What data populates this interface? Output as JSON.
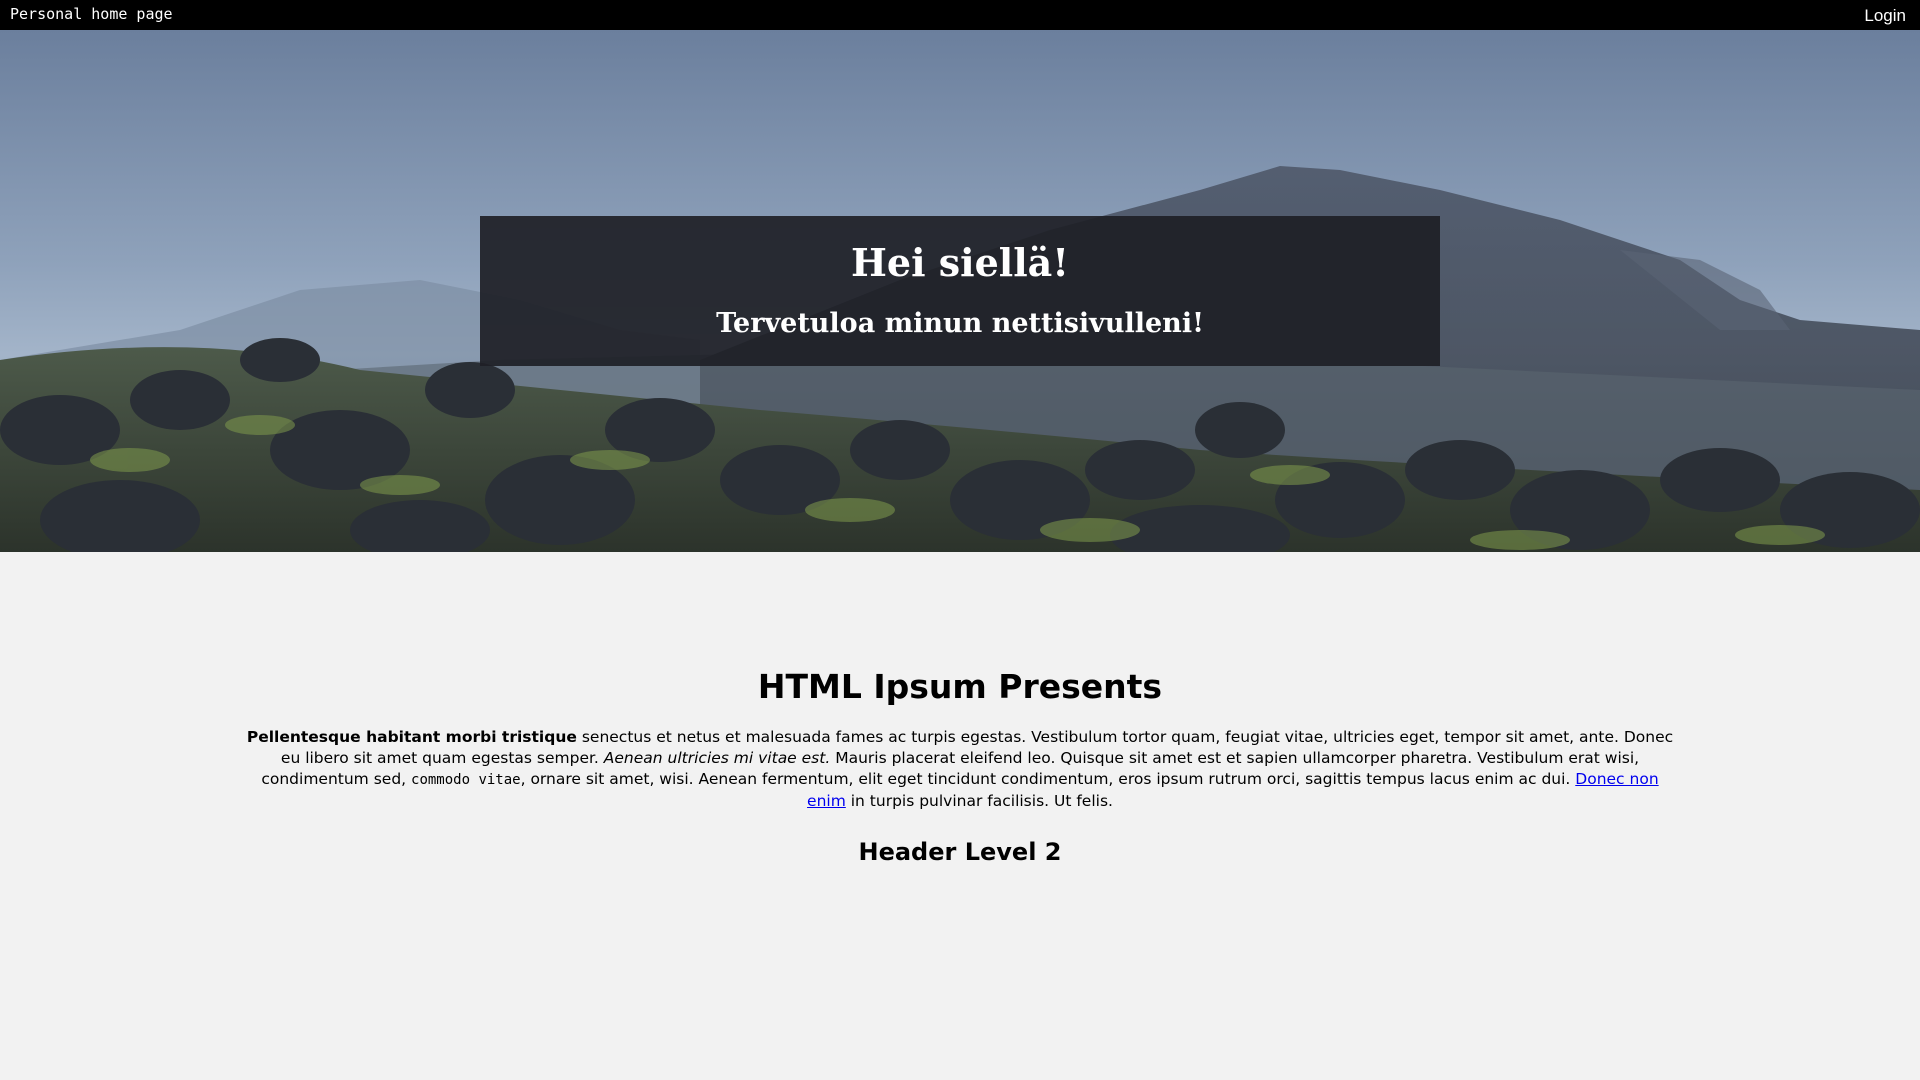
{
  "header": {
    "site_title": "Personal home page",
    "login_label": "Login"
  },
  "hero": {
    "title": "Hei siellä!",
    "subtitle": "Tervetuloa minun nettisivulleni!"
  },
  "content": {
    "heading": "HTML Ipsum Presents",
    "paragraph": {
      "bold": "Pellentesque habitant morbi tristique",
      "text1": " senectus et netus et malesuada fames ac turpis egestas. Vestibulum tortor quam, feugiat vitae, ultricies eget, tempor sit amet, ante. Donec eu libero sit amet quam egestas semper. ",
      "italic": "Aenean ultricies mi vitae est.",
      "text2": " Mauris placerat eleifend leo. Quisque sit amet est et sapien ullamcorper pharetra. Vestibulum erat wisi, condimentum sed, ",
      "code": "commodo vitae",
      "text3": ", ornare sit amet, wisi. Aenean fermentum, elit eget tincidunt condimentum, eros ipsum rutrum orci, sagittis tempus lacus enim ac dui. ",
      "link": "Donec non enim",
      "text4": " in turpis pulvinar facilisis. Ut felis."
    },
    "subheading": "Header Level 2"
  },
  "colors": {
    "topbar": "#000000",
    "page_background": "#f2f2f2",
    "welcome_box": "#1e2026",
    "link": "#0000ee"
  }
}
